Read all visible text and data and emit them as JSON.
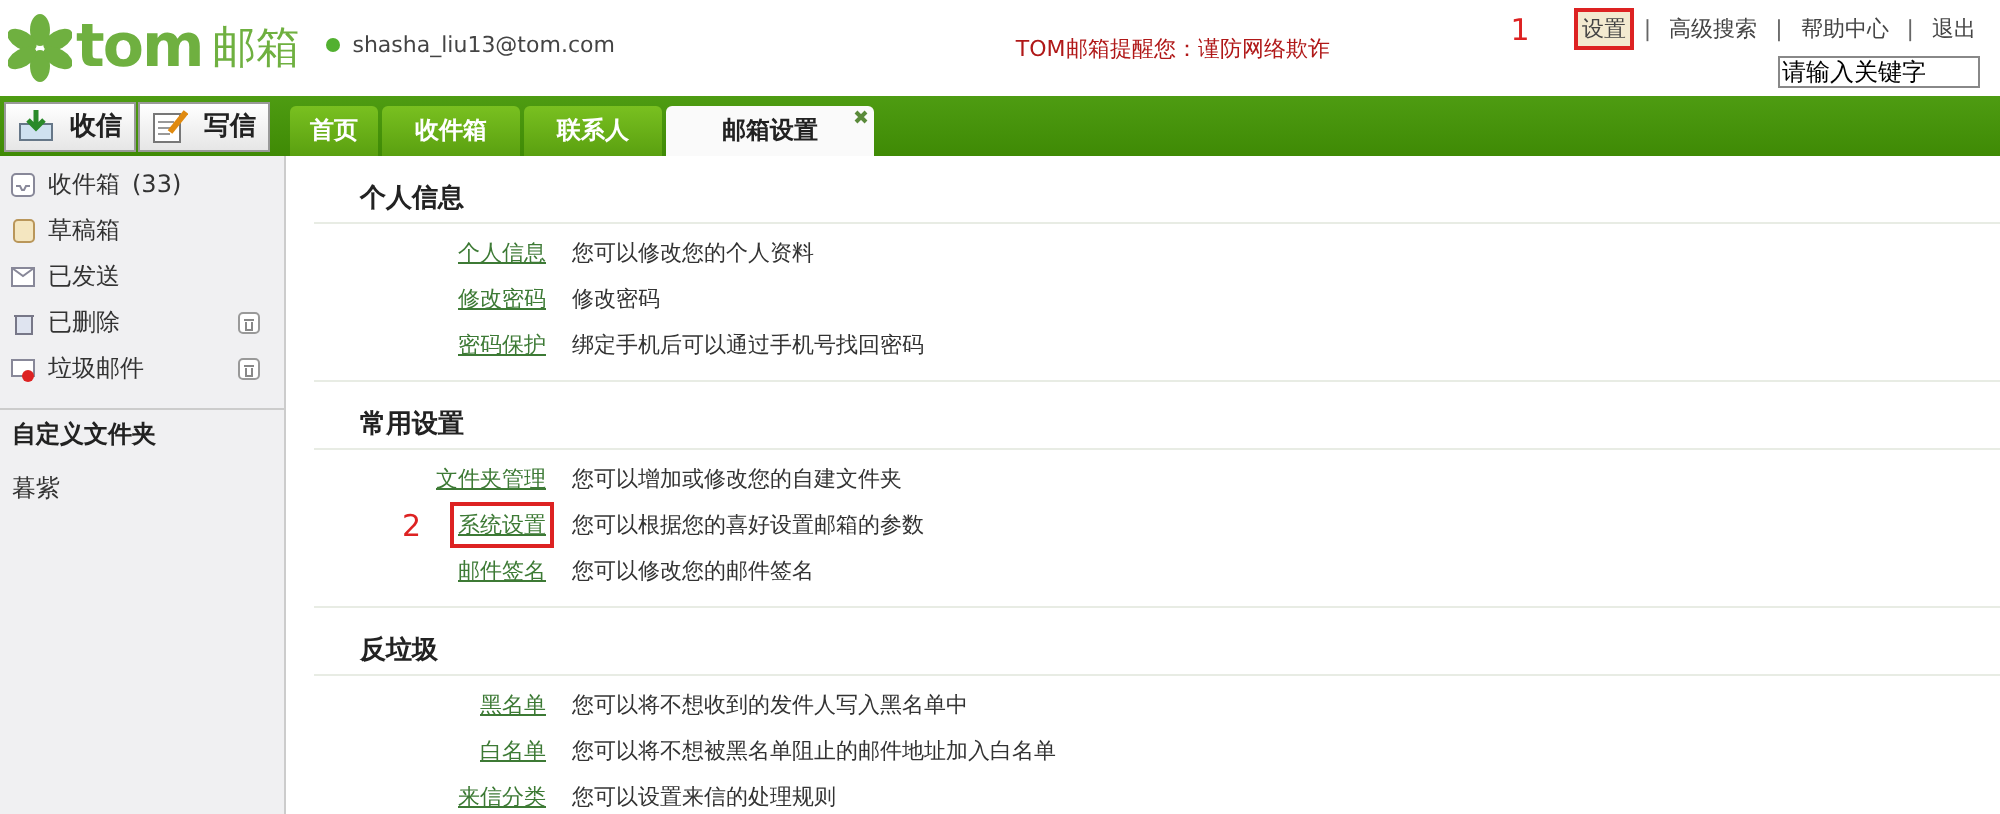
{
  "header": {
    "logo": {
      "mark": "tom",
      "text": "邮箱"
    },
    "user_email": "shasha_liu13@tom.com",
    "online": true,
    "notice": "TOM邮箱提醒您：谨防网络欺诈",
    "link_separator": "|",
    "links": [
      {
        "label": "设置",
        "highlighted": true,
        "annotation": "1"
      },
      {
        "label": "高级搜索",
        "highlighted": false
      },
      {
        "label": "帮助中心",
        "highlighted": false
      },
      {
        "label": "退出",
        "highlighted": false
      }
    ],
    "search": {
      "placeholder": "请输入关键字"
    }
  },
  "actions": [
    {
      "label": "收信",
      "kind": "receive"
    },
    {
      "label": "写信",
      "kind": "compose"
    }
  ],
  "tabs": [
    {
      "label": "首页",
      "selected": false,
      "closable": false
    },
    {
      "label": "收件箱",
      "selected": false,
      "closable": false
    },
    {
      "label": "联系人",
      "selected": false,
      "closable": false
    },
    {
      "label": "邮箱设置",
      "selected": true,
      "closable": true
    }
  ],
  "sidebar": {
    "folders": [
      {
        "label": "收件箱",
        "count": "(33)",
        "kind": "inbox",
        "clearable": false
      },
      {
        "label": "草稿箱",
        "kind": "drafts",
        "clearable": false
      },
      {
        "label": "已发送",
        "kind": "sent",
        "clearable": false
      },
      {
        "label": "已删除",
        "kind": "trash",
        "clearable": true
      },
      {
        "label": "垃圾邮件",
        "kind": "spam",
        "clearable": true
      }
    ],
    "custom_folders": {
      "title": "自定义文件夹",
      "items": [
        "暮紫"
      ]
    }
  },
  "sections": [
    {
      "title": "个人信息",
      "rows": [
        {
          "link": "个人信息",
          "description": "您可以修改您的个人资料",
          "highlighted": false
        },
        {
          "link": "修改密码",
          "description": "修改密码",
          "highlighted": false
        },
        {
          "link": "密码保护",
          "description": "绑定手机后可以通过手机号找回密码",
          "highlighted": false
        }
      ]
    },
    {
      "title": "常用设置",
      "rows": [
        {
          "link": "文件夹管理",
          "description": "您可以增加或修改您的自建文件夹",
          "highlighted": false
        },
        {
          "link": "系统设置",
          "description": "您可以根据您的喜好设置邮箱的参数",
          "highlighted": true,
          "annotation": "2"
        },
        {
          "link": "邮件签名",
          "description": "您可以修改您的邮件签名",
          "highlighted": false
        }
      ]
    },
    {
      "title": "反垃圾",
      "rows": [
        {
          "link": "黑名单",
          "description": "您可以将不想收到的发件人写入黑名单中",
          "highlighted": false
        },
        {
          "link": "白名单",
          "description": "您可以将不想被黑名单阻止的邮件地址加入白名单",
          "highlighted": false
        },
        {
          "link": "来信分类",
          "description": "您可以设置来信的处理规则",
          "highlighted": false
        }
      ]
    }
  ]
}
